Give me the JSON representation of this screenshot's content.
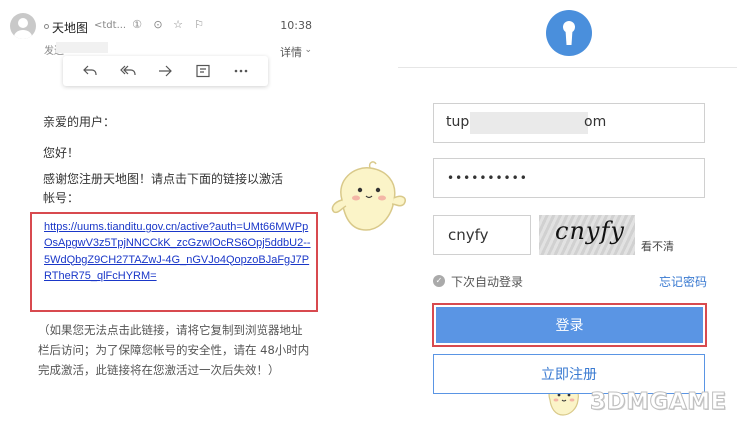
{
  "email": {
    "sender_name": "天地图",
    "sender_addr": "<tdt...",
    "time": "10:38",
    "to_label": "发送",
    "details_label": "详情",
    "greeting": "亲爱的用户：",
    "hello": "您好！",
    "message": "感谢您注册天地图！请点击下面的链接以激活帐号：",
    "activation_link": "https://uums.tianditu.gov.cn/active?auth=UMt66MWPpOsApgwV3z5TpjNNCCkK_zcGzwlOcRS6Opj5ddbU2--5WdQbgZ9CH27TAZwJ-4G_nGVJo4QopzoBJaFgJ7PRTheR75_qlFcHYRM=",
    "note": "（如果您无法点击此链接，请将它复制到浏览器地址栏后访问；为了保障您帐号的安全性，请在 48小时内完成激活，此链接将在您激活过一次后失效！）",
    "toolbar_icons": [
      "reply-icon",
      "reply-all-icon",
      "forward-icon",
      "note-icon",
      "more-icon"
    ]
  },
  "login": {
    "account_prefix": "tup",
    "account_suffix": "om",
    "password_mask": "••••••••••",
    "captcha_value": "cnyfy",
    "captcha_image_text": "cnyfy",
    "refresh_label": "看不清",
    "remember_label": "下次自动登录",
    "forgot_label": "忘记密码",
    "login_label": "登录",
    "register_label": "立即注册"
  },
  "watermark": {
    "text": "3DMGAME"
  },
  "colors": {
    "accent_blue": "#5a95e4",
    "logo_blue": "#4a8fdc",
    "link_blue": "#1a37c8",
    "highlight_red": "#d84a4f"
  }
}
